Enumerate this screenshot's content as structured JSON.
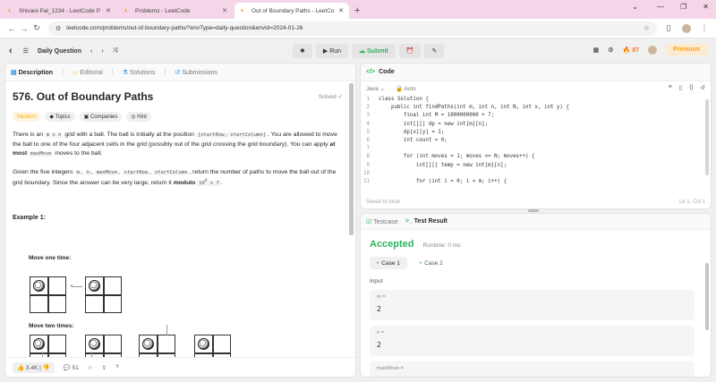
{
  "browser": {
    "tabs": [
      {
        "title": "Shivani-Pal_1234 - LeetCode P"
      },
      {
        "title": "Problems - LeetCode"
      },
      {
        "title": "Out of Boundary Paths - LeetCo"
      }
    ],
    "url": "leetcode.com/problems/out-of-boundary-paths/?envType=daily-question&envId=2024-01-26"
  },
  "header": {
    "daily_label": "Daily Question",
    "run_label": "Run",
    "submit_label": "Submit",
    "streak": "87",
    "premium_label": "Premium"
  },
  "left": {
    "tabs": [
      "Description",
      "Editorial",
      "Solutions",
      "Submissions"
    ],
    "title": "576. Out of Boundary Paths",
    "status": "Solved",
    "tags": [
      "Medium",
      "Topics",
      "Companies",
      "Hint"
    ],
    "para1_a": "There is an ",
    "para1_code1": "m x n",
    "para1_b": " grid with a ball. The ball is initially at the position ",
    "para1_code2": "[startRow, startColumn]",
    "para1_c": ". You are allowed to move the ball to one of the four adjacent cells in the grid (possibly out of the grid crossing the grid boundary). You can apply ",
    "para1_bold": "at most",
    "para1_code3": "maxMove",
    "para1_d": " moves to the ball.",
    "para2_a": "Given the five integers ",
    "para2_codes": [
      "m",
      "n",
      "maxMove",
      "startRow",
      "startColumn"
    ],
    "para2_b": ", return the number of paths to move the ball out of the grid boundary. Since the answer can be very large, return it ",
    "para2_bold": "modulo",
    "para2_code": "10",
    "para2_sup": "9",
    "para2_code_b": " + 7",
    "para2_end": ".",
    "example_title": "Example 1:",
    "move_one": "Move one time:",
    "move_two": "Move two times:",
    "likes": "3.4K",
    "comments": "51"
  },
  "code": {
    "tab_label": "Code",
    "language": "Java",
    "mode": "Auto",
    "lines": [
      "class Solution {",
      "    public int findPaths(int m, int n, int N, int x, int y) {",
      "        final int M = 1000000000 + 7;",
      "        int[][] dp = new int[m][n];",
      "        dp[x][y] = 1;",
      "        int count = 0;",
      "",
      "        for (int moves = 1; moves <= N; moves++) {",
      "            int[][] temp = new int[m][n];",
      "",
      "            for (int i = 0; i < m; i++) {"
    ],
    "saved_text": "Saved to local",
    "cursor": "Ln 1, Col 1"
  },
  "test": {
    "tabs": [
      "Testcase",
      "Test Result"
    ],
    "result": "Accepted",
    "runtime": "Runtime: 0 ms",
    "cases": [
      "Case 1",
      "Case 2"
    ],
    "input_label": "Input",
    "vars": [
      {
        "name": "m =",
        "value": "2"
      },
      {
        "name": "n =",
        "value": "2"
      }
    ],
    "next_var": "maxMove ="
  }
}
